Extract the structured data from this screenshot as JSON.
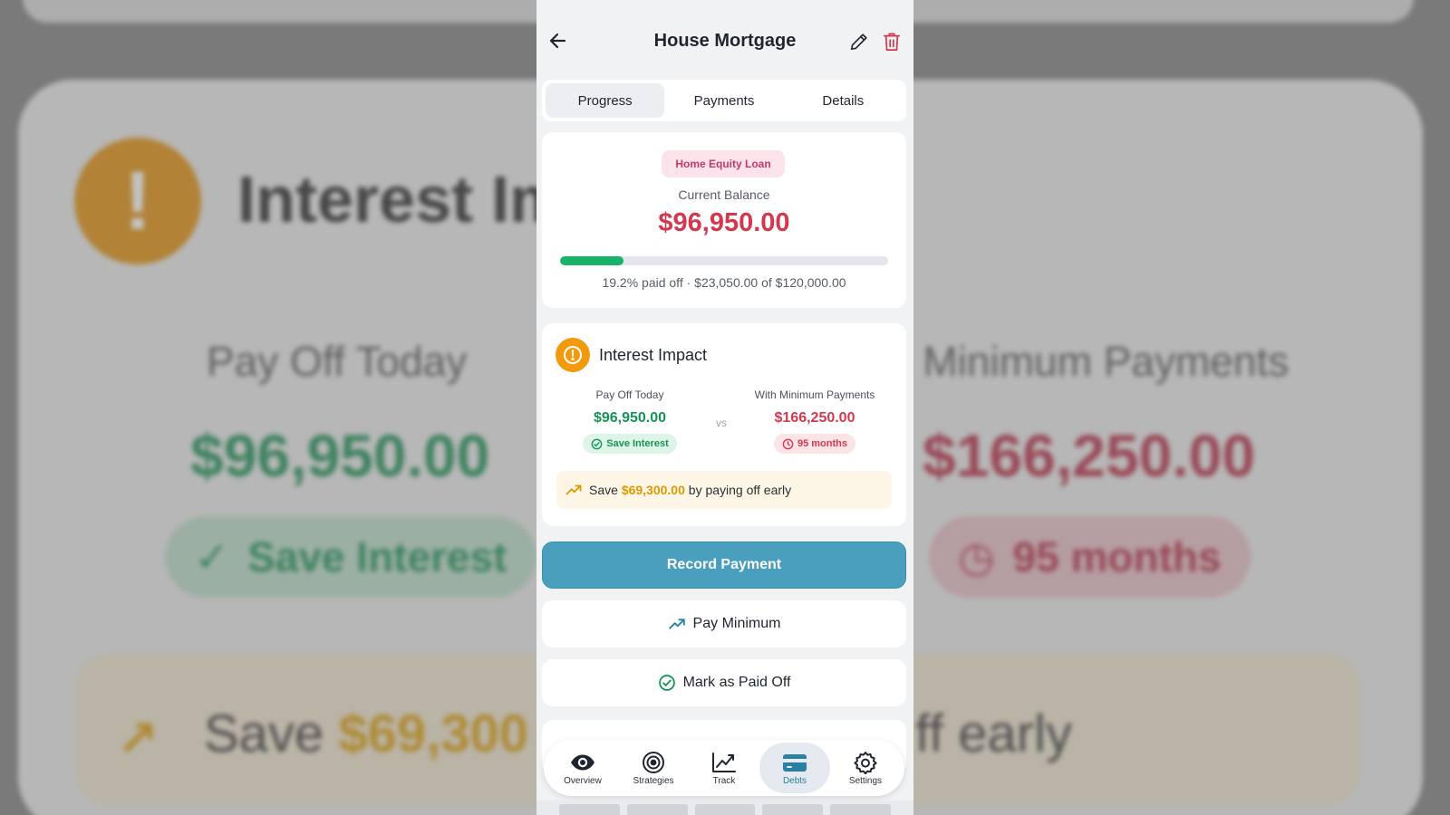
{
  "background": {
    "title": "Interest Im",
    "left_label": "Pay Off Today",
    "right_label": "n Minimum Payments",
    "left_amount": "$96,950.00",
    "right_amount": "$166,250.00",
    "left_pill": "Save Interest",
    "right_pill": "95 months",
    "save_prefix": "Save",
    "save_amount": "$69,300",
    "save_suffix": "ff early"
  },
  "header": {
    "title": "House Mortgage"
  },
  "tabs": [
    {
      "label": "Progress",
      "active": true
    },
    {
      "label": "Payments",
      "active": false
    },
    {
      "label": "Details",
      "active": false
    }
  ],
  "balance": {
    "badge": "Home Equity Loan",
    "label": "Current Balance",
    "amount": "$96,950.00",
    "progress_percent": 19.2,
    "progress_text": "19.2% paid off · $23,050.00 of $120,000.00"
  },
  "interest_impact": {
    "title": "Interest Impact",
    "left": {
      "label": "Pay Off Today",
      "amount": "$96,950.00",
      "pill": "Save Interest"
    },
    "vs": "vs",
    "right": {
      "label": "With Minimum Payments",
      "amount": "$166,250.00",
      "pill": "95 months"
    },
    "save_prefix": "Save",
    "save_amount": "$69,300.00",
    "save_suffix": "by paying off early"
  },
  "actions": {
    "record_payment": "Record Payment",
    "pay_minimum": "Pay Minimum",
    "mark_paid_off": "Mark as Paid Off"
  },
  "nav": [
    {
      "label": "Overview",
      "icon": "eye-icon"
    },
    {
      "label": "Strategies",
      "icon": "target-icon"
    },
    {
      "label": "Track",
      "icon": "chart-line-icon"
    },
    {
      "label": "Debts",
      "icon": "card-icon",
      "active": true
    },
    {
      "label": "Settings",
      "icon": "gear-icon"
    }
  ],
  "colors": {
    "accent": "#4a9fbe",
    "balance_red": "#d3384e",
    "progress_green": "#17b36b",
    "save_gold": "#d99a00",
    "impact_orange": "#f29a0e"
  }
}
